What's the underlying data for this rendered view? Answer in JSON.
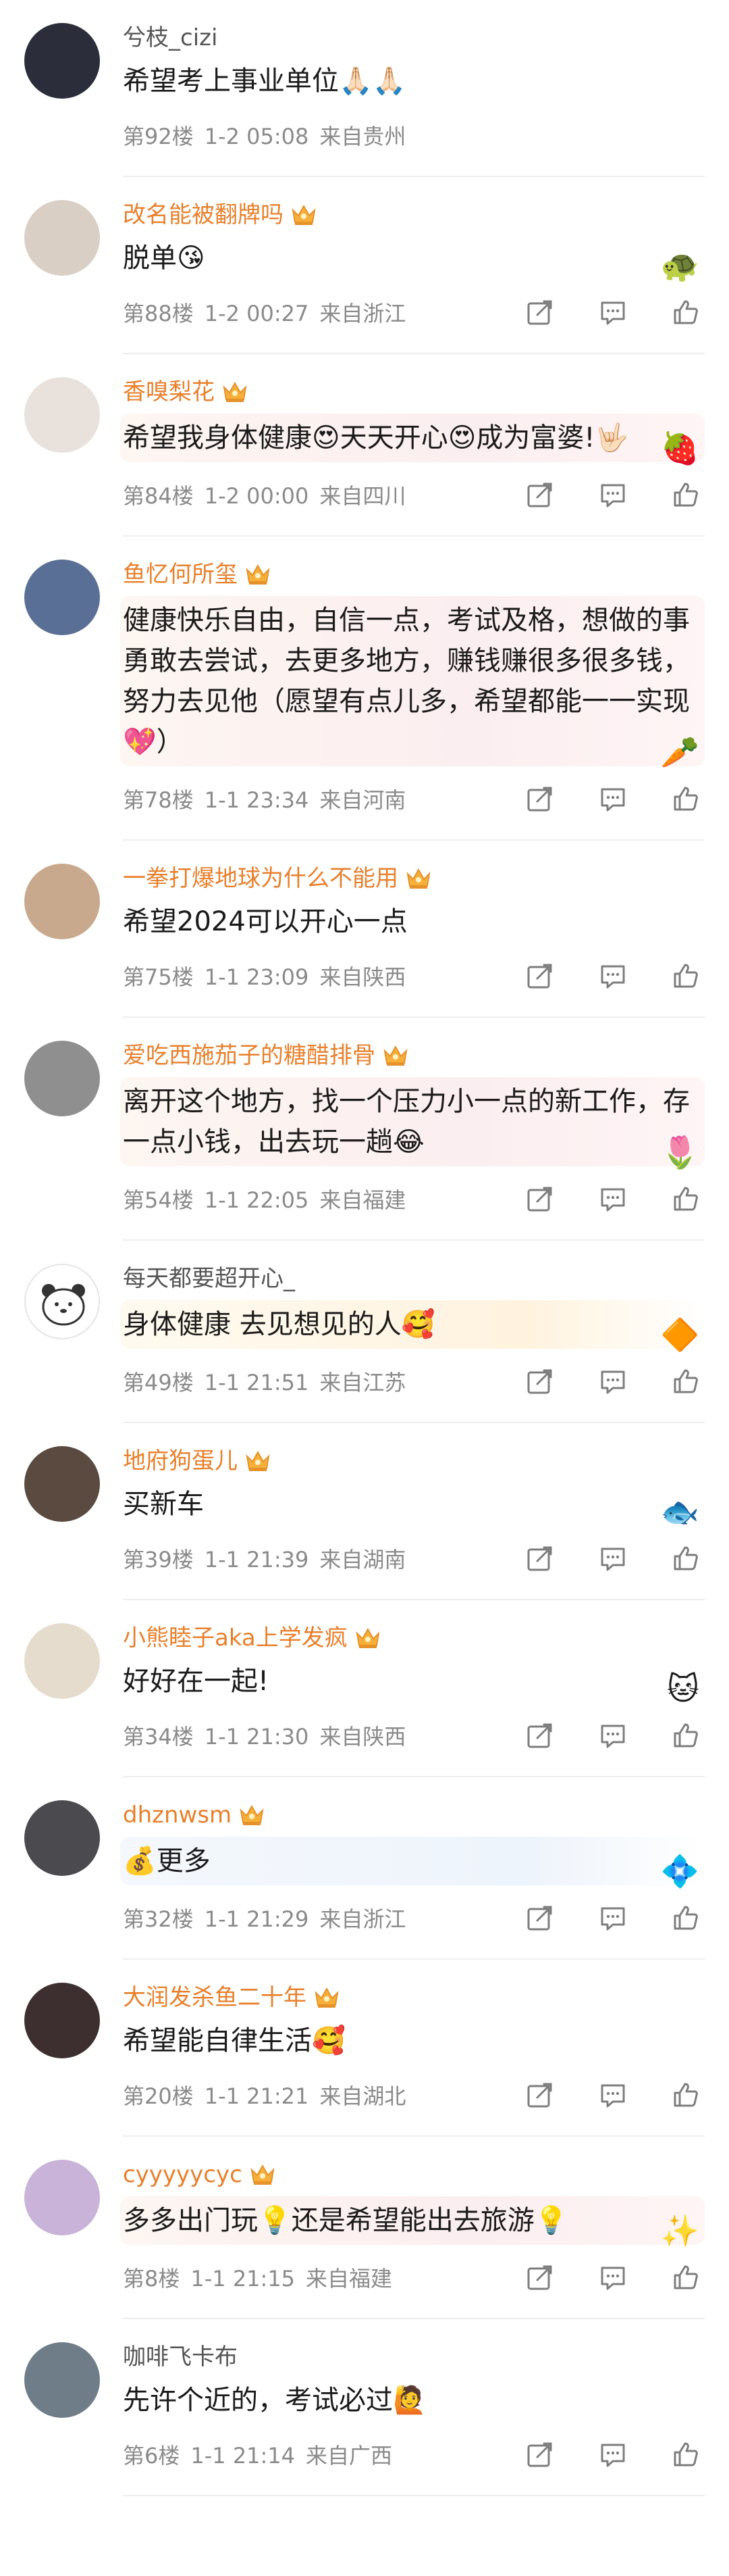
{
  "comments": [
    {
      "user": "兮枝_cizi",
      "vip": false,
      "text": "希望考上事业单位🙏🏻🙏🏻",
      "floor": "第92楼",
      "time": "1-2 05:08",
      "location": "来自贵州",
      "avatar_color": "#2b2d3a",
      "deco": "",
      "sticker": "",
      "show_actions": false
    },
    {
      "user": "改名能被翻牌吗",
      "vip": true,
      "text": "脱单😘",
      "floor": "第88楼",
      "time": "1-2 00:27",
      "location": "来自浙江",
      "avatar_color": "#d9cfc4",
      "deco": "",
      "sticker": "🐢",
      "show_actions": true
    },
    {
      "user": "香嗅梨花",
      "vip": true,
      "text": "希望我身体健康😍天天开心😍成为富婆!🤟🏻",
      "floor": "第84楼",
      "time": "1-2 00:00",
      "location": "来自四川",
      "avatar_color": "#e9e2dc",
      "deco": "pink",
      "sticker": "🍓",
      "show_actions": true
    },
    {
      "user": "鱼忆何所玺",
      "vip": true,
      "text": "健康快乐自由，自信一点，考试及格，想做的事勇敢去尝试，去更多地方，赚钱赚很多很多钱，努力去见他（愿望有点儿多，希望都能一一实现💖）",
      "floor": "第78楼",
      "time": "1-1 23:34",
      "location": "来自河南",
      "avatar_color": "#5a6f96",
      "deco": "pink",
      "sticker": "🥕",
      "show_actions": true
    },
    {
      "user": "一拳打爆地球为什么不能用",
      "vip": true,
      "text": "希望2024可以开心一点",
      "floor": "第75楼",
      "time": "1-1 23:09",
      "location": "来自陕西",
      "avatar_color": "#c9a98d",
      "deco": "",
      "sticker": "",
      "show_actions": true
    },
    {
      "user": "爱吃西施茄子的糖醋排骨",
      "vip": true,
      "text": "离开这个地方，找一个压力小一点的新工作，存一点小钱，出去玩一趟😂",
      "floor": "第54楼",
      "time": "1-1 22:05",
      "location": "来自福建",
      "avatar_color": "#8f8f8f",
      "deco": "pink",
      "sticker": "🌷",
      "show_actions": true
    },
    {
      "user": "每天都要超开心_",
      "vip": false,
      "text": "身体健康 去见想见的人🥰",
      "floor": "第49楼",
      "time": "1-1 21:51",
      "location": "来自江苏",
      "avatar_color": "#ffffff",
      "deco": "gold",
      "sticker": "🔶",
      "show_actions": true
    },
    {
      "user": "地府狗蛋儿",
      "vip": true,
      "text": "买新车",
      "floor": "第39楼",
      "time": "1-1 21:39",
      "location": "来自湖南",
      "avatar_color": "#5b4a3f",
      "deco": "",
      "sticker": "🐟",
      "show_actions": true
    },
    {
      "user": "小熊睦子aka上学发疯",
      "vip": true,
      "text": "好好在一起!",
      "floor": "第34楼",
      "time": "1-1 21:30",
      "location": "来自陕西",
      "avatar_color": "#e6dccd",
      "deco": "",
      "sticker": "🐱",
      "show_actions": true
    },
    {
      "user": "dhznwsm",
      "vip": true,
      "text": "💰更多",
      "floor": "第32楼",
      "time": "1-1 21:29",
      "location": "来自浙江",
      "avatar_color": "#4a4a4f",
      "deco": "blue",
      "sticker": "💠",
      "show_actions": true
    },
    {
      "user": "大润发杀鱼二十年",
      "vip": true,
      "text": "希望能自律生活🥰",
      "floor": "第20楼",
      "time": "1-1 21:21",
      "location": "来自湖北",
      "avatar_color": "#3d2f2f",
      "deco": "",
      "sticker": "",
      "show_actions": true
    },
    {
      "user": "cyyyyycyc",
      "vip": true,
      "text": "多多出门玩💡还是希望能出去旅游💡",
      "floor": "第8楼",
      "time": "1-1 21:15",
      "location": "来自福建",
      "avatar_color": "#c9b3d9",
      "deco": "pink",
      "sticker": "✨",
      "show_actions": true
    },
    {
      "user": "咖啡飞卡布",
      "vip": false,
      "text": "先许个近的，考试必过🙋",
      "floor": "第6楼",
      "time": "1-1 21:14",
      "location": "来自广西",
      "avatar_color": "#6f7d88",
      "deco": "",
      "sticker": "",
      "show_actions": true
    }
  ],
  "icons": {
    "share": "share-icon",
    "comment": "comment-icon",
    "like": "like-icon",
    "crown": "vip-crown-icon"
  },
  "colors": {
    "vip_name": "#e8802c",
    "plain_name": "#555555",
    "meta": "#8a8a8a",
    "divider": "#eeeeee"
  }
}
